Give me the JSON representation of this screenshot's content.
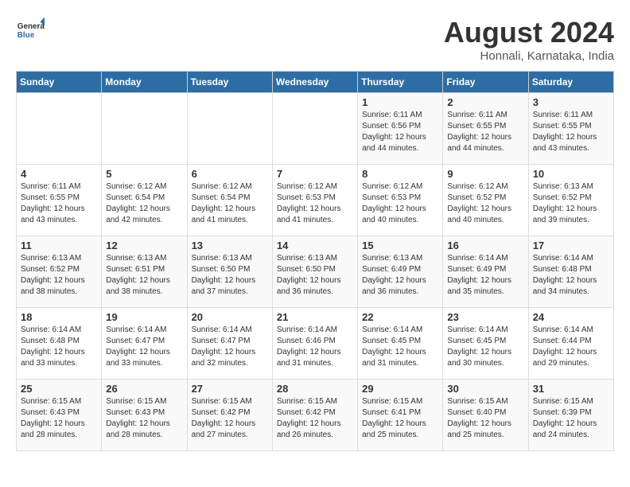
{
  "header": {
    "logo_line1": "General",
    "logo_line2": "Blue",
    "month_year": "August 2024",
    "location": "Honnali, Karnataka, India"
  },
  "days_of_week": [
    "Sunday",
    "Monday",
    "Tuesday",
    "Wednesday",
    "Thursday",
    "Friday",
    "Saturday"
  ],
  "weeks": [
    [
      {
        "day": "",
        "info": ""
      },
      {
        "day": "",
        "info": ""
      },
      {
        "day": "",
        "info": ""
      },
      {
        "day": "",
        "info": ""
      },
      {
        "day": "1",
        "info": "Sunrise: 6:11 AM\nSunset: 6:56 PM\nDaylight: 12 hours\nand 44 minutes."
      },
      {
        "day": "2",
        "info": "Sunrise: 6:11 AM\nSunset: 6:55 PM\nDaylight: 12 hours\nand 44 minutes."
      },
      {
        "day": "3",
        "info": "Sunrise: 6:11 AM\nSunset: 6:55 PM\nDaylight: 12 hours\nand 43 minutes."
      }
    ],
    [
      {
        "day": "4",
        "info": "Sunrise: 6:11 AM\nSunset: 6:55 PM\nDaylight: 12 hours\nand 43 minutes."
      },
      {
        "day": "5",
        "info": "Sunrise: 6:12 AM\nSunset: 6:54 PM\nDaylight: 12 hours\nand 42 minutes."
      },
      {
        "day": "6",
        "info": "Sunrise: 6:12 AM\nSunset: 6:54 PM\nDaylight: 12 hours\nand 41 minutes."
      },
      {
        "day": "7",
        "info": "Sunrise: 6:12 AM\nSunset: 6:53 PM\nDaylight: 12 hours\nand 41 minutes."
      },
      {
        "day": "8",
        "info": "Sunrise: 6:12 AM\nSunset: 6:53 PM\nDaylight: 12 hours\nand 40 minutes."
      },
      {
        "day": "9",
        "info": "Sunrise: 6:12 AM\nSunset: 6:52 PM\nDaylight: 12 hours\nand 40 minutes."
      },
      {
        "day": "10",
        "info": "Sunrise: 6:13 AM\nSunset: 6:52 PM\nDaylight: 12 hours\nand 39 minutes."
      }
    ],
    [
      {
        "day": "11",
        "info": "Sunrise: 6:13 AM\nSunset: 6:52 PM\nDaylight: 12 hours\nand 38 minutes."
      },
      {
        "day": "12",
        "info": "Sunrise: 6:13 AM\nSunset: 6:51 PM\nDaylight: 12 hours\nand 38 minutes."
      },
      {
        "day": "13",
        "info": "Sunrise: 6:13 AM\nSunset: 6:50 PM\nDaylight: 12 hours\nand 37 minutes."
      },
      {
        "day": "14",
        "info": "Sunrise: 6:13 AM\nSunset: 6:50 PM\nDaylight: 12 hours\nand 36 minutes."
      },
      {
        "day": "15",
        "info": "Sunrise: 6:13 AM\nSunset: 6:49 PM\nDaylight: 12 hours\nand 36 minutes."
      },
      {
        "day": "16",
        "info": "Sunrise: 6:14 AM\nSunset: 6:49 PM\nDaylight: 12 hours\nand 35 minutes."
      },
      {
        "day": "17",
        "info": "Sunrise: 6:14 AM\nSunset: 6:48 PM\nDaylight: 12 hours\nand 34 minutes."
      }
    ],
    [
      {
        "day": "18",
        "info": "Sunrise: 6:14 AM\nSunset: 6:48 PM\nDaylight: 12 hours\nand 33 minutes."
      },
      {
        "day": "19",
        "info": "Sunrise: 6:14 AM\nSunset: 6:47 PM\nDaylight: 12 hours\nand 33 minutes."
      },
      {
        "day": "20",
        "info": "Sunrise: 6:14 AM\nSunset: 6:47 PM\nDaylight: 12 hours\nand 32 minutes."
      },
      {
        "day": "21",
        "info": "Sunrise: 6:14 AM\nSunset: 6:46 PM\nDaylight: 12 hours\nand 31 minutes."
      },
      {
        "day": "22",
        "info": "Sunrise: 6:14 AM\nSunset: 6:45 PM\nDaylight: 12 hours\nand 31 minutes."
      },
      {
        "day": "23",
        "info": "Sunrise: 6:14 AM\nSunset: 6:45 PM\nDaylight: 12 hours\nand 30 minutes."
      },
      {
        "day": "24",
        "info": "Sunrise: 6:14 AM\nSunset: 6:44 PM\nDaylight: 12 hours\nand 29 minutes."
      }
    ],
    [
      {
        "day": "25",
        "info": "Sunrise: 6:15 AM\nSunset: 6:43 PM\nDaylight: 12 hours\nand 28 minutes."
      },
      {
        "day": "26",
        "info": "Sunrise: 6:15 AM\nSunset: 6:43 PM\nDaylight: 12 hours\nand 28 minutes."
      },
      {
        "day": "27",
        "info": "Sunrise: 6:15 AM\nSunset: 6:42 PM\nDaylight: 12 hours\nand 27 minutes."
      },
      {
        "day": "28",
        "info": "Sunrise: 6:15 AM\nSunset: 6:42 PM\nDaylight: 12 hours\nand 26 minutes."
      },
      {
        "day": "29",
        "info": "Sunrise: 6:15 AM\nSunset: 6:41 PM\nDaylight: 12 hours\nand 25 minutes."
      },
      {
        "day": "30",
        "info": "Sunrise: 6:15 AM\nSunset: 6:40 PM\nDaylight: 12 hours\nand 25 minutes."
      },
      {
        "day": "31",
        "info": "Sunrise: 6:15 AM\nSunset: 6:39 PM\nDaylight: 12 hours\nand 24 minutes."
      }
    ]
  ]
}
